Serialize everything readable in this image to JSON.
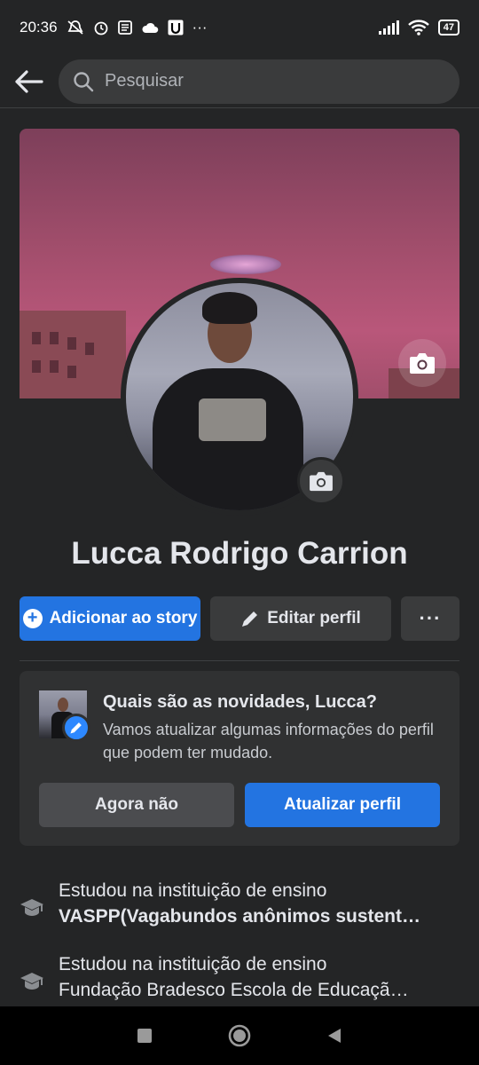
{
  "status_bar": {
    "time": "20:36",
    "battery": "47",
    "more_dots": "···"
  },
  "search": {
    "placeholder": "Pesquisar"
  },
  "profile": {
    "name": "Lucca Rodrigo Carrion"
  },
  "actions": {
    "add_story": "Adicionar ao story",
    "edit_profile": "Editar perfil",
    "more": "···"
  },
  "update_card": {
    "title": "Quais são as novidades, Lucca?",
    "description": "Vamos atualizar algumas informações do perfil que podem ter mudado.",
    "later_label": "Agora não",
    "update_label": "Atualizar perfil"
  },
  "education": [
    {
      "line1": "Estudou na instituição de ensino",
      "line2": "VASPP(Vagabundos anônimos sustent…"
    },
    {
      "line1": "Estudou na instituição de ensino",
      "line2": "Fundação Bradesco Escola de Educaçã…"
    }
  ],
  "icons": {
    "back": "arrow-left-icon",
    "search": "search-icon",
    "camera": "camera-icon",
    "pencil": "pencil-icon",
    "plus": "plus-icon",
    "education": "graduation-cap-icon"
  },
  "colors": {
    "primary_blue": "#2374e1",
    "background": "#242526",
    "card": "#303132"
  }
}
